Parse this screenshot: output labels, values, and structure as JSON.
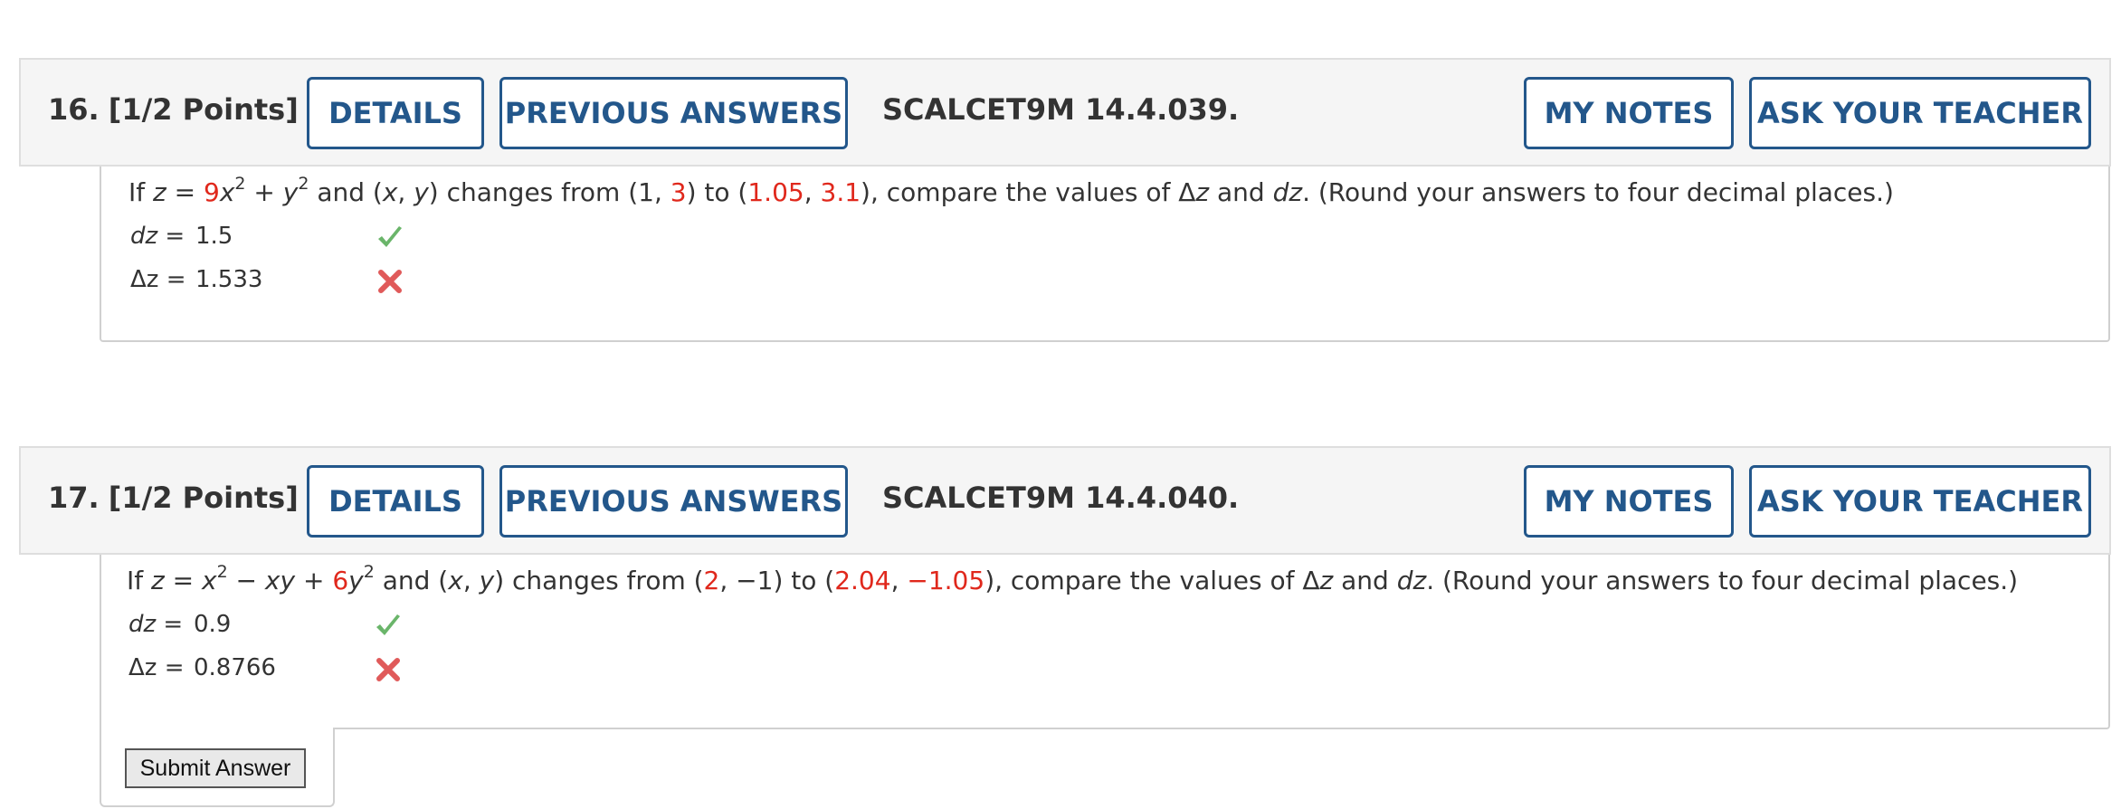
{
  "q16": {
    "number": "16.",
    "points": "[1/2 Points]",
    "details_label": "DETAILS",
    "previous_label": "PREVIOUS ANSWERS",
    "code": "SCALCET9M 14.4.039.",
    "notes_label": "MY NOTES",
    "ask_label": "ASK YOUR TEACHER",
    "prompt": {
      "t1": "If ",
      "z": "z",
      "t2": " = ",
      "coef": "9",
      "x": "x",
      "sup1": "2",
      "t3": " + ",
      "y": "y",
      "sup2": "2",
      "t4": " and (",
      "x2": "x",
      "t5": ", ",
      "y2": "y",
      "t6": ") changes from (1, ",
      "r1": "3",
      "t7": ") to (",
      "r2": "1.05",
      "t8": ", ",
      "r3": "3.1",
      "t9": "), compare the values of Δ",
      "z2": "z",
      "t10": " and ",
      "dz": "dz",
      "t11": ". (Round your answers to four decimal places.)"
    },
    "dz_label": "dz",
    "dz_eq": " =  ",
    "dz_value": "1.5",
    "dz_status": "correct",
    "delta_label": "Δz",
    "delta_eq": " =  ",
    "delta_value": "1.533",
    "delta_status": "incorrect"
  },
  "q17": {
    "number": "17.",
    "points": "[1/2 Points]",
    "details_label": "DETAILS",
    "previous_label": "PREVIOUS ANSWERS",
    "code": "SCALCET9M 14.4.040.",
    "notes_label": "MY NOTES",
    "ask_label": "ASK YOUR TEACHER",
    "prompt": {
      "t1": "If ",
      "z": "z",
      "t2": " = ",
      "x": "x",
      "sup1": "2",
      "t3": " − ",
      "xy": "xy",
      "t4": " + ",
      "coef": "6",
      "y": "y",
      "sup2": "2",
      "t5": " and (",
      "x2": "x",
      "t6": ", ",
      "y2": "y",
      "t7": ") changes from (",
      "r1": "2",
      "t8": ", −1) to (",
      "r2": "2.04",
      "t9": ", ",
      "r3": "−1.05",
      "t10": "), compare the values of Δ",
      "z2": "z",
      "t11": " and ",
      "dz": "dz",
      "t12": ". (Round your answers to four decimal places.)"
    },
    "dz_label": "dz",
    "dz_eq": " =  ",
    "dz_value": "0.9",
    "dz_status": "correct",
    "delta_label": "Δz",
    "delta_eq": " =  ",
    "delta_value": "0.8766",
    "delta_status": "incorrect",
    "submit_label": "Submit Answer"
  },
  "colors": {
    "button_border": "#23578b",
    "highlight_red": "#e0281c",
    "check_green": "#5cb85c",
    "cross_red": "#e05a5a"
  },
  "icons": {
    "correct": "checkmark-icon",
    "incorrect": "x-mark-icon"
  }
}
